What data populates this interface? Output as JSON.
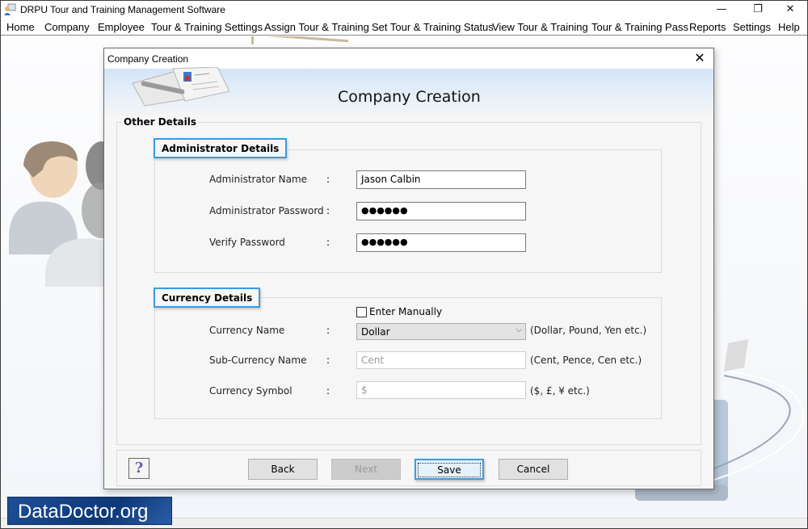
{
  "app": {
    "title": "DRPU Tour and Training Management Software",
    "window_controls": {
      "minimize": "—",
      "maximize": "❐",
      "close": "✕"
    }
  },
  "menu": [
    "Home",
    "Company",
    "Employee",
    "Tour & Training Settings",
    "Assign Tour & Training",
    "Set Tour & Training Status",
    "View Tour & Training",
    "Tour & Training Pass",
    "Reports",
    "Settings",
    "Help"
  ],
  "dialog": {
    "window_title": "Company Creation",
    "close_glyph": "✕",
    "banner_title": "Company Creation",
    "group_title": "Other Details",
    "admin": {
      "section_title": "Administrator Details",
      "fields": [
        {
          "label": "Administrator Name",
          "colon": ":",
          "value": "Jason Calbin"
        },
        {
          "label": "Administrator Password",
          "colon": ":",
          "value": "●●●●●●"
        },
        {
          "label": "Verify Password",
          "colon": ":",
          "value": "●●●●●●"
        }
      ]
    },
    "currency": {
      "section_title": "Currency Details",
      "enter_manually": {
        "label": "Enter Manually",
        "checked": false
      },
      "fields": [
        {
          "label": "Currency Name",
          "colon": ":",
          "value": "Dollar",
          "hint": "(Dollar, Pound, Yen etc.)",
          "arrow": "⌵"
        },
        {
          "label": "Sub-Currency Name",
          "colon": ":",
          "value": "Cent",
          "hint": "(Cent, Pence, Cen etc.)"
        },
        {
          "label": "Currency Symbol",
          "colon": ":",
          "value": "$",
          "hint": "($, £, ¥ etc.)"
        }
      ]
    },
    "buttons": {
      "help": "?",
      "back": "Back",
      "next": "Next",
      "save": "Save",
      "cancel": "Cancel"
    }
  },
  "branding": {
    "text": "DataDoctor.org"
  }
}
